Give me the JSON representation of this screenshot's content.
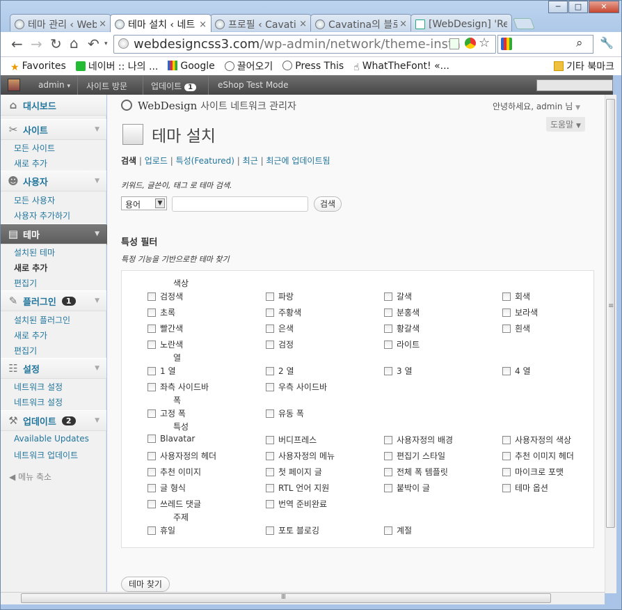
{
  "window": {
    "minimize": "─",
    "maximize": "□",
    "close": "✕"
  },
  "tabs": [
    {
      "label": "테마 관리 ‹ WebD",
      "active": false
    },
    {
      "label": "테마 설치 ‹ 네트",
      "active": true
    },
    {
      "label": "프로필 ‹ Cavatina",
      "active": false
    },
    {
      "label": "Cavatina의 블로그",
      "active": false
    },
    {
      "label": "[WebDesign] 'Re",
      "active": false
    }
  ],
  "tab_close": "×",
  "url": {
    "host": "webdesigncss3.com",
    "path": "/wp-admin/network/theme-insta"
  },
  "bookmarks": [
    "Favorites",
    "네이버 :: 나의 ...",
    "Google",
    "끌어오기",
    "Press This",
    "WhatTheFont! «..."
  ],
  "bookmarks_other": "기타 북마크",
  "adminbar": {
    "user": "admin",
    "visit": "사이트 방문",
    "updates": "업데이트",
    "updates_count": "1",
    "eshop": "eShop Test Mode"
  },
  "sidebar": {
    "dashboard": "대시보드",
    "sites": {
      "label": "사이트",
      "items": [
        "모든 사이트",
        "새로 추가"
      ]
    },
    "users": {
      "label": "사용자",
      "items": [
        "모든 사용자",
        "사용자 추가하기"
      ]
    },
    "themes": {
      "label": "테마",
      "items": [
        "설치된 테마",
        "새로 추가",
        "편집기"
      ]
    },
    "plugins": {
      "label": "플러그인",
      "count": "1",
      "items": [
        "설치된 플러그인",
        "새로 추가",
        "편집기"
      ]
    },
    "settings": {
      "label": "설정",
      "items": [
        "네트워크 설정",
        "네트워크 설정"
      ]
    },
    "updates": {
      "label": "업데이트",
      "count": "2",
      "items": [
        "Available Updates",
        "네트워크 업데이트"
      ]
    },
    "collapse": "메뉴 축소"
  },
  "header": {
    "site": "WebDesign",
    "site_suffix": "사이트 네트워크 관리자",
    "greeting": "안녕하세요, admin 님",
    "help": "도움말"
  },
  "page_title": "테마 설치",
  "subnav": [
    "검색",
    "업로드",
    "특성(Featured)",
    "최근",
    "최근에 업데이트됨"
  ],
  "search": {
    "hint": "키워드, 글쓴이, 태그 로 테마 검색.",
    "select": "용어",
    "button": "검색"
  },
  "filter": {
    "title": "특성 필터",
    "hint": "특정 기능을 기반으로한 테마 찾기",
    "button": "테마 찾기"
  },
  "groups": [
    {
      "label": "색상",
      "items": [
        "검정색",
        "파랑",
        "갈색",
        "회색",
        "초록",
        "주황색",
        "분홍색",
        "보라색",
        "빨간색",
        "은색",
        "황갈색",
        "흰색",
        "노란색",
        "검정",
        "라이트"
      ]
    },
    {
      "label": "열",
      "items": [
        "1 열",
        "2 열",
        "3 열",
        "4 열",
        "좌측 사이드바",
        "우측 사이드바"
      ]
    },
    {
      "label": "폭",
      "items": [
        "고정 폭",
        "유동 폭"
      ]
    },
    {
      "label": "특성",
      "items": [
        "Blavatar",
        "버디프레스",
        "사용자정의 배경",
        "사용자정의 색상",
        "사용자정의 헤더",
        "사용자정의 메뉴",
        "편집기 스타일",
        "추천 이미지 헤더",
        "추천 이미지",
        "첫 페이지 글",
        "전체 폭 템플릿",
        "마이크로 포맷",
        "글 형식",
        "RTL 언어 지원",
        "붙박이 글",
        "테마 옵션",
        "쓰레드 댓글",
        "번역 준비완료"
      ]
    },
    {
      "label": "주제",
      "items": [
        "휴일",
        "포토 블로깅",
        "계절"
      ]
    }
  ]
}
